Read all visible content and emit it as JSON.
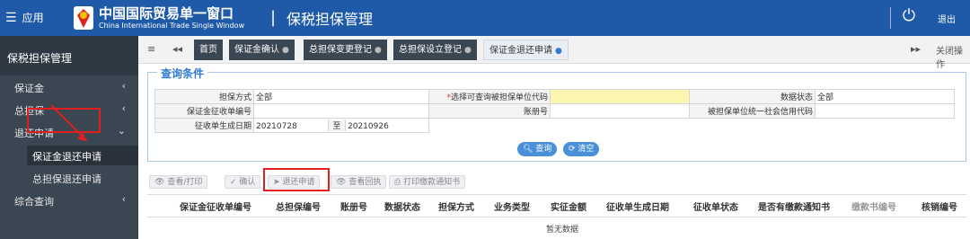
{
  "header": {
    "app_menu": "应用",
    "brand_cn": "中国国际贸易单一窗口",
    "brand_en": "China International Trade Single Window",
    "separator": "|",
    "page_title": "保税担保管理",
    "logout": "退出"
  },
  "sidebar": {
    "title": "保税担保管理",
    "items": [
      {
        "label": "保证金"
      },
      {
        "label": "总担保"
      },
      {
        "label": "退还申请"
      },
      {
        "label": "保证金退还申请"
      },
      {
        "label": "总担保退还申请"
      },
      {
        "label": "综合查询"
      }
    ]
  },
  "tabs": [
    {
      "label": "首页"
    },
    {
      "label": "保证金确认"
    },
    {
      "label": "总担保变更登记"
    },
    {
      "label": "总担保设立登记"
    },
    {
      "label": "保证金退还申请"
    }
  ],
  "tab_controls": {
    "close_ops": "关闭操作"
  },
  "query": {
    "title": "查询条件",
    "rows": [
      [
        {
          "label": "担保方式",
          "value": "全部"
        },
        {
          "label": "选择可查询被担保单位代码",
          "required": "*",
          "value": ""
        },
        {
          "label": "数据状态",
          "value": "全部"
        }
      ],
      [
        {
          "label": "保证金征收单编号",
          "value": ""
        },
        {
          "label": "账册号",
          "value": ""
        },
        {
          "label": "被担保单位统一社会信用代码",
          "value": ""
        }
      ]
    ],
    "date_label": "征收单生成日期",
    "date_from": "20210728",
    "date_to_label": "至",
    "date_to": "20210926",
    "search_btn": "查询",
    "clear_btn": "清空"
  },
  "toolbar": [
    {
      "label": "查看/打印"
    },
    {
      "label": "确认"
    },
    {
      "label": "退还申请"
    },
    {
      "label": "查看回执"
    },
    {
      "label": "打印缴款通知书"
    }
  ],
  "grid": {
    "columns": [
      "保证金征收单编号",
      "总担保编号",
      "账册号",
      "数据状态",
      "担保方式",
      "业务类型",
      "实征金额",
      "征收单生成日期",
      "征收单状态",
      "是否有缴款通知书",
      "缴款书编号",
      "核销编号"
    ],
    "empty_text": "暂无数据"
  },
  "colors": {
    "header": "#1f5aa8",
    "sidebar": "#3b4653",
    "accent": "#2f7ad1",
    "highlight": "#e02020"
  }
}
